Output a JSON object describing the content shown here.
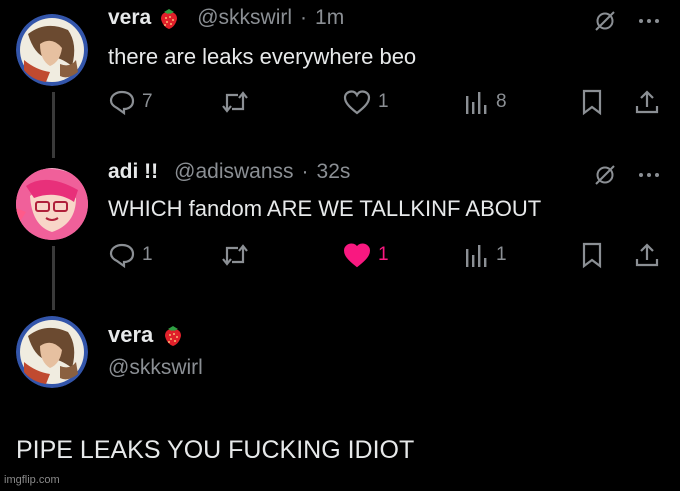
{
  "tweets": [
    {
      "name": "vera",
      "name_emoji": "strawberry-emoji",
      "handle": "@skkswirl",
      "separator": "·",
      "time": "1m",
      "text": "there are leaks everywhere beo",
      "replies": "7",
      "retweets": "",
      "likes": "1",
      "liked": false,
      "views": "8"
    },
    {
      "name": "adi !!",
      "handle": "@adiswanss",
      "separator": "·",
      "time": "32s",
      "text": "WHICH fandom ARE WE TALLKINF ABOUT",
      "replies": "1",
      "retweets": "",
      "likes": "1",
      "liked": true,
      "views": "1"
    }
  ],
  "focused_tweet": {
    "name": "vera",
    "name_emoji": "strawberry-emoji",
    "handle": "@skkswirl",
    "text": "PIPE LEAKS YOU FUCKING IDIOT"
  },
  "watermark": "imgflip.com",
  "colors": {
    "background": "#000000",
    "text": "#e7e9ea",
    "muted": "#8b8f94",
    "like_pink": "#f91880",
    "thread_line": "#3a3a3a"
  },
  "icons": [
    "reply-icon",
    "retweet-icon",
    "like-icon",
    "views-icon",
    "bookmark-icon",
    "share-icon",
    "grok-icon",
    "more-icon"
  ]
}
